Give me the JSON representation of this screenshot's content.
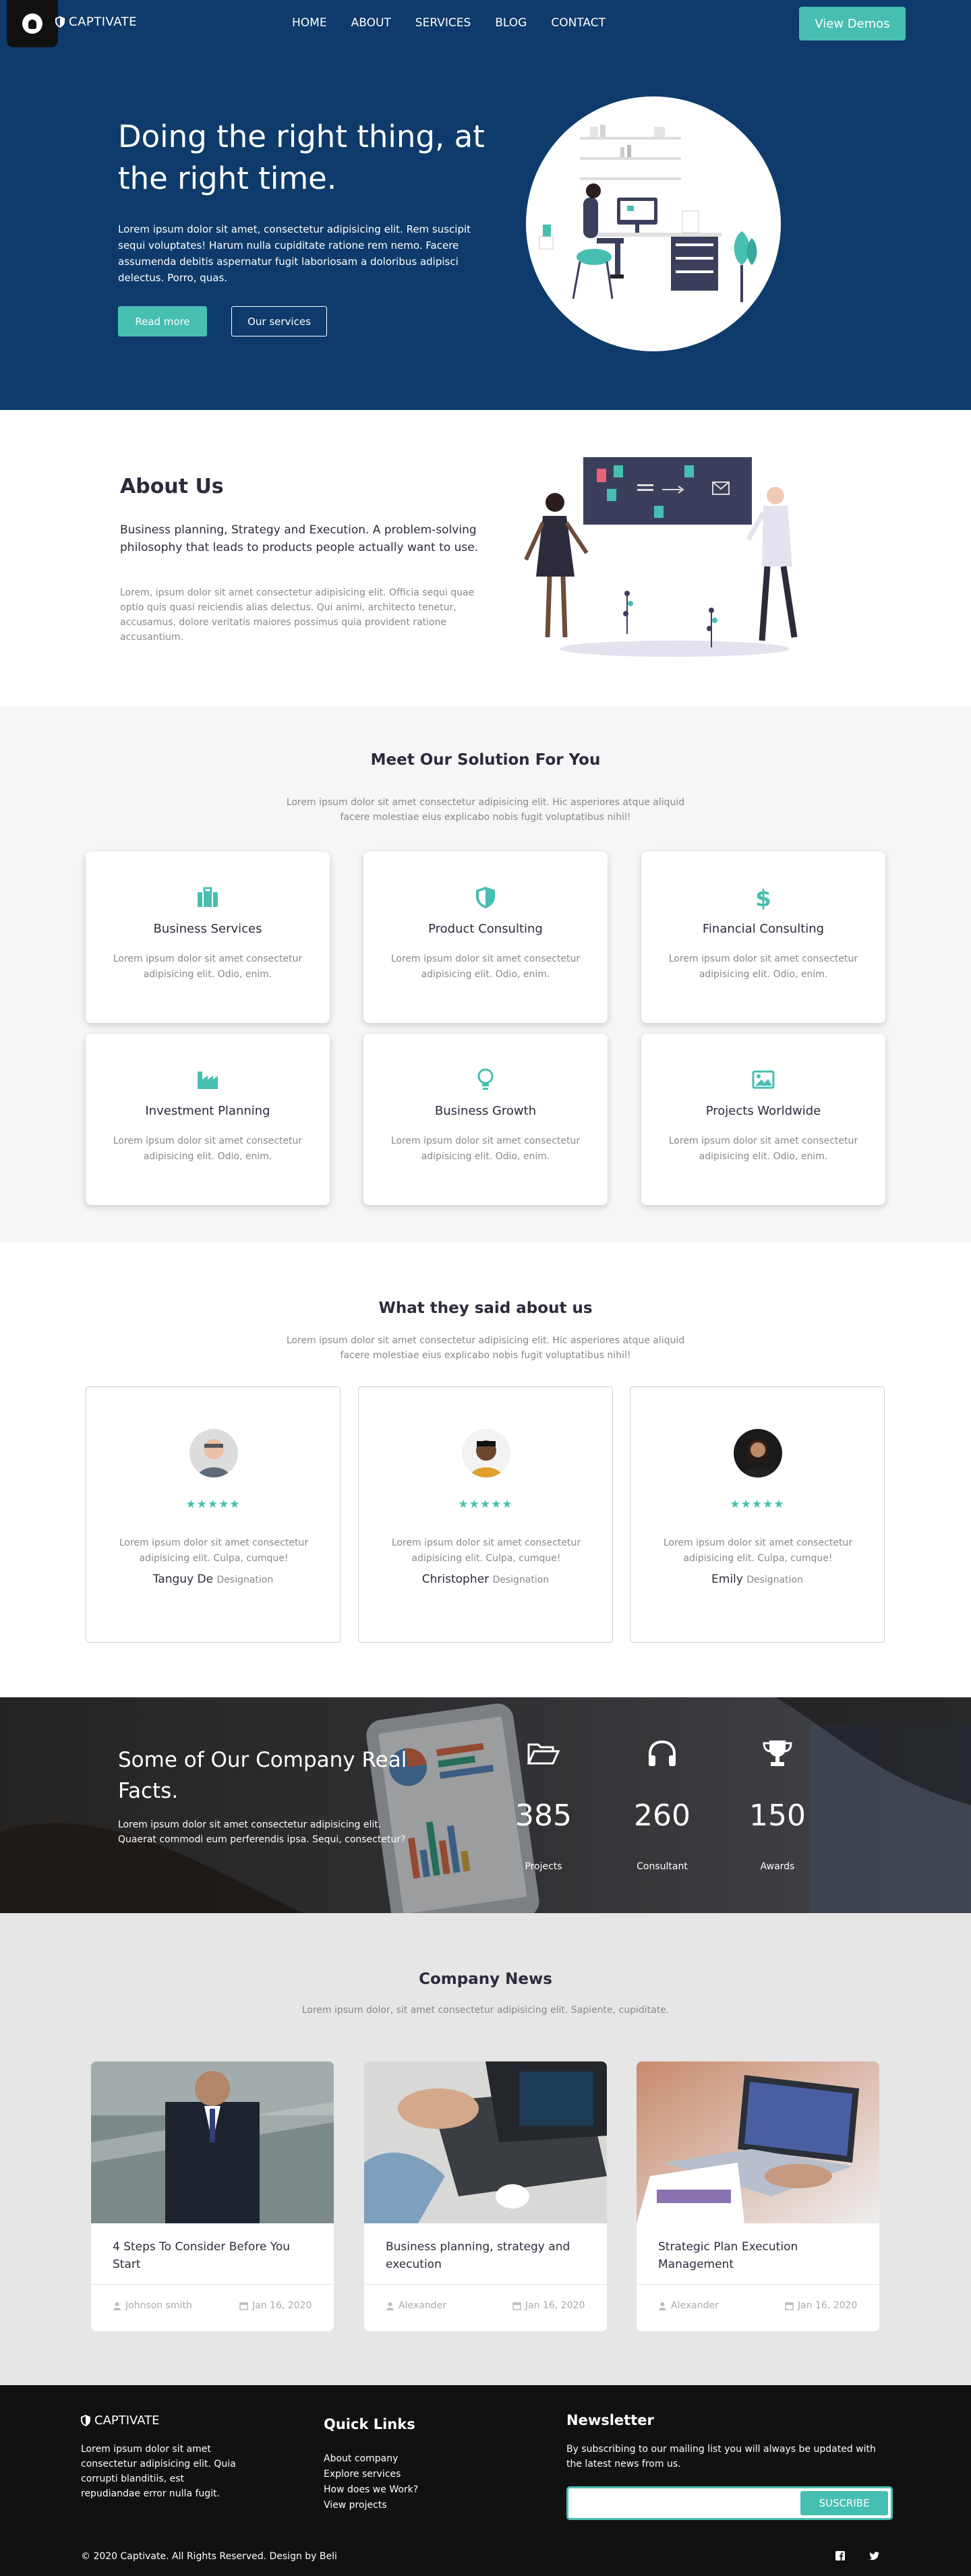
{
  "colors": {
    "navy": "#0e3b6b",
    "teal": "#46bfb2",
    "dark": "#111111"
  },
  "header": {
    "brand": "CAPTIVATE",
    "nav": [
      "HOME",
      "ABOUT",
      "SERVICES",
      "BLOG",
      "CONTACT"
    ],
    "cta": "View Demos"
  },
  "hero": {
    "title": "Doing the right thing, at the right time.",
    "text": "Lorem ipsum dolor sit amet, consectetur adipisicing elit. Rem suscipit sequi voluptates! Harum nulla cupiditate ratione rem nemo. Facere assumenda debitis aspernatur fugit laboriosam a doloribus adipisci delectus. Porro, quas.",
    "btn_primary": "Read more",
    "btn_secondary": "Our services"
  },
  "about": {
    "title": "About Us",
    "lead": "Business planning, Strategy and Execution. A problem-solving philosophy that leads to products people actually want to use.",
    "text": "Lorem, ipsum dolor sit amet consectetur adipisicing elit. Officia sequi quae optio quis quasi reiciendis alias delectus. Qui animi, architecto tenetur, accusamus, dolore veritatis maiores possimus quia provident ratione accusantium."
  },
  "services": {
    "title": "Meet Our Solution For You",
    "subtitle": "Lorem ipsum dolor sit amet consectetur adipisicing elit. Hic asperiores atque aliquid facere molestiae eius explicabo nobis fugit voluptatibus nihil!",
    "items": [
      {
        "icon": "briefcase-icon",
        "title": "Business Services",
        "text": "Lorem ipsum dolor sit amet consectetur adipisicing elit. Odio, enim."
      },
      {
        "icon": "shield-icon",
        "title": "Product Consulting",
        "text": "Lorem ipsum dolor sit amet consectetur adipisicing elit. Odio, enim."
      },
      {
        "icon": "dollar-icon",
        "title": "Financial Consulting",
        "text": "Lorem ipsum dolor sit amet consectetur adipisicing elit. Odio, enim."
      },
      {
        "icon": "industry-icon",
        "title": "Investment Planning",
        "text": "Lorem ipsum dolor sit amet consectetur adipisicing elit. Odio, enim."
      },
      {
        "icon": "lightbulb-icon",
        "title": "Business Growth",
        "text": "Lorem ipsum dolor sit amet consectetur adipisicing elit. Odio, enim."
      },
      {
        "icon": "image-icon",
        "title": "Projects Worldwide",
        "text": "Lorem ipsum dolor sit amet consectetur adipisicing elit. Odio, enim."
      }
    ]
  },
  "testimonials": {
    "title": "What they said about us",
    "subtitle": "Lorem ipsum dolor sit amet consectetur adipisicing elit. Hic asperiores atque aliquid facere molestiae eius explicabo nobis fugit voluptatibus nihil!",
    "items": [
      {
        "stars": "★★★★★",
        "quote": "Lorem ipsum dolor sit amet consectetur adipisicing elit. Culpa, cumque!",
        "name": "Tanguy De",
        "role": "Designation"
      },
      {
        "stars": "★★★★★",
        "quote": "Lorem ipsum dolor sit amet consectetur adipisicing elit. Culpa, cumque!",
        "name": "Christopher",
        "role": "Designation"
      },
      {
        "stars": "★★★★★",
        "quote": "Lorem ipsum dolor sit amet consectetur adipisicing elit. Culpa, cumque!",
        "name": "Emily",
        "role": "Designation"
      }
    ]
  },
  "facts": {
    "title": "Some of Our Company Real Facts.",
    "text": "Lorem ipsum dolor sit amet consectetur adipisicing elit. Quaerat commodi eum perferendis ipsa. Sequi, consectetur?",
    "items": [
      {
        "icon": "folder-open-icon",
        "value": "385",
        "label": "Projects"
      },
      {
        "icon": "headphones-icon",
        "value": "260",
        "label": "Consultant"
      },
      {
        "icon": "trophy-icon",
        "value": "150",
        "label": "Awards"
      }
    ]
  },
  "news": {
    "title": "Company News",
    "subtitle": "Lorem ipsum dolor, sit amet consectetur adipisicing elit. Sapiente, cupiditate.",
    "items": [
      {
        "title": "4 Steps To Consider Before You Start",
        "author": "Johnson smith",
        "date": "Jan 16, 2020"
      },
      {
        "title": "Business planning, strategy and execution",
        "author": "Alexander",
        "date": "Jan 16, 2020"
      },
      {
        "title": "Strategic Plan Execution Management",
        "author": "Alexander",
        "date": "Jan 16, 2020"
      }
    ]
  },
  "footer": {
    "brand": "CAPTIVATE",
    "about": "Lorem ipsum dolor sit amet consectetur adipisicing elit. Quia corrupti blanditiis, est repudiandae error nulla fugit.",
    "quick_links_title": "Quick Links",
    "links": [
      "About company",
      "Explore services",
      "How does we Work?",
      "View projects"
    ],
    "newsletter_title": "Newsletter",
    "newsletter_text": "By subscribing to our mailing list you will always be updated with the latest news from us.",
    "subscribe": "SUSCRIBE",
    "copyright": "© 2020 Captivate. All Rights Reserved. Design by Beli",
    "social": [
      "facebook-icon",
      "twitter-icon"
    ]
  }
}
